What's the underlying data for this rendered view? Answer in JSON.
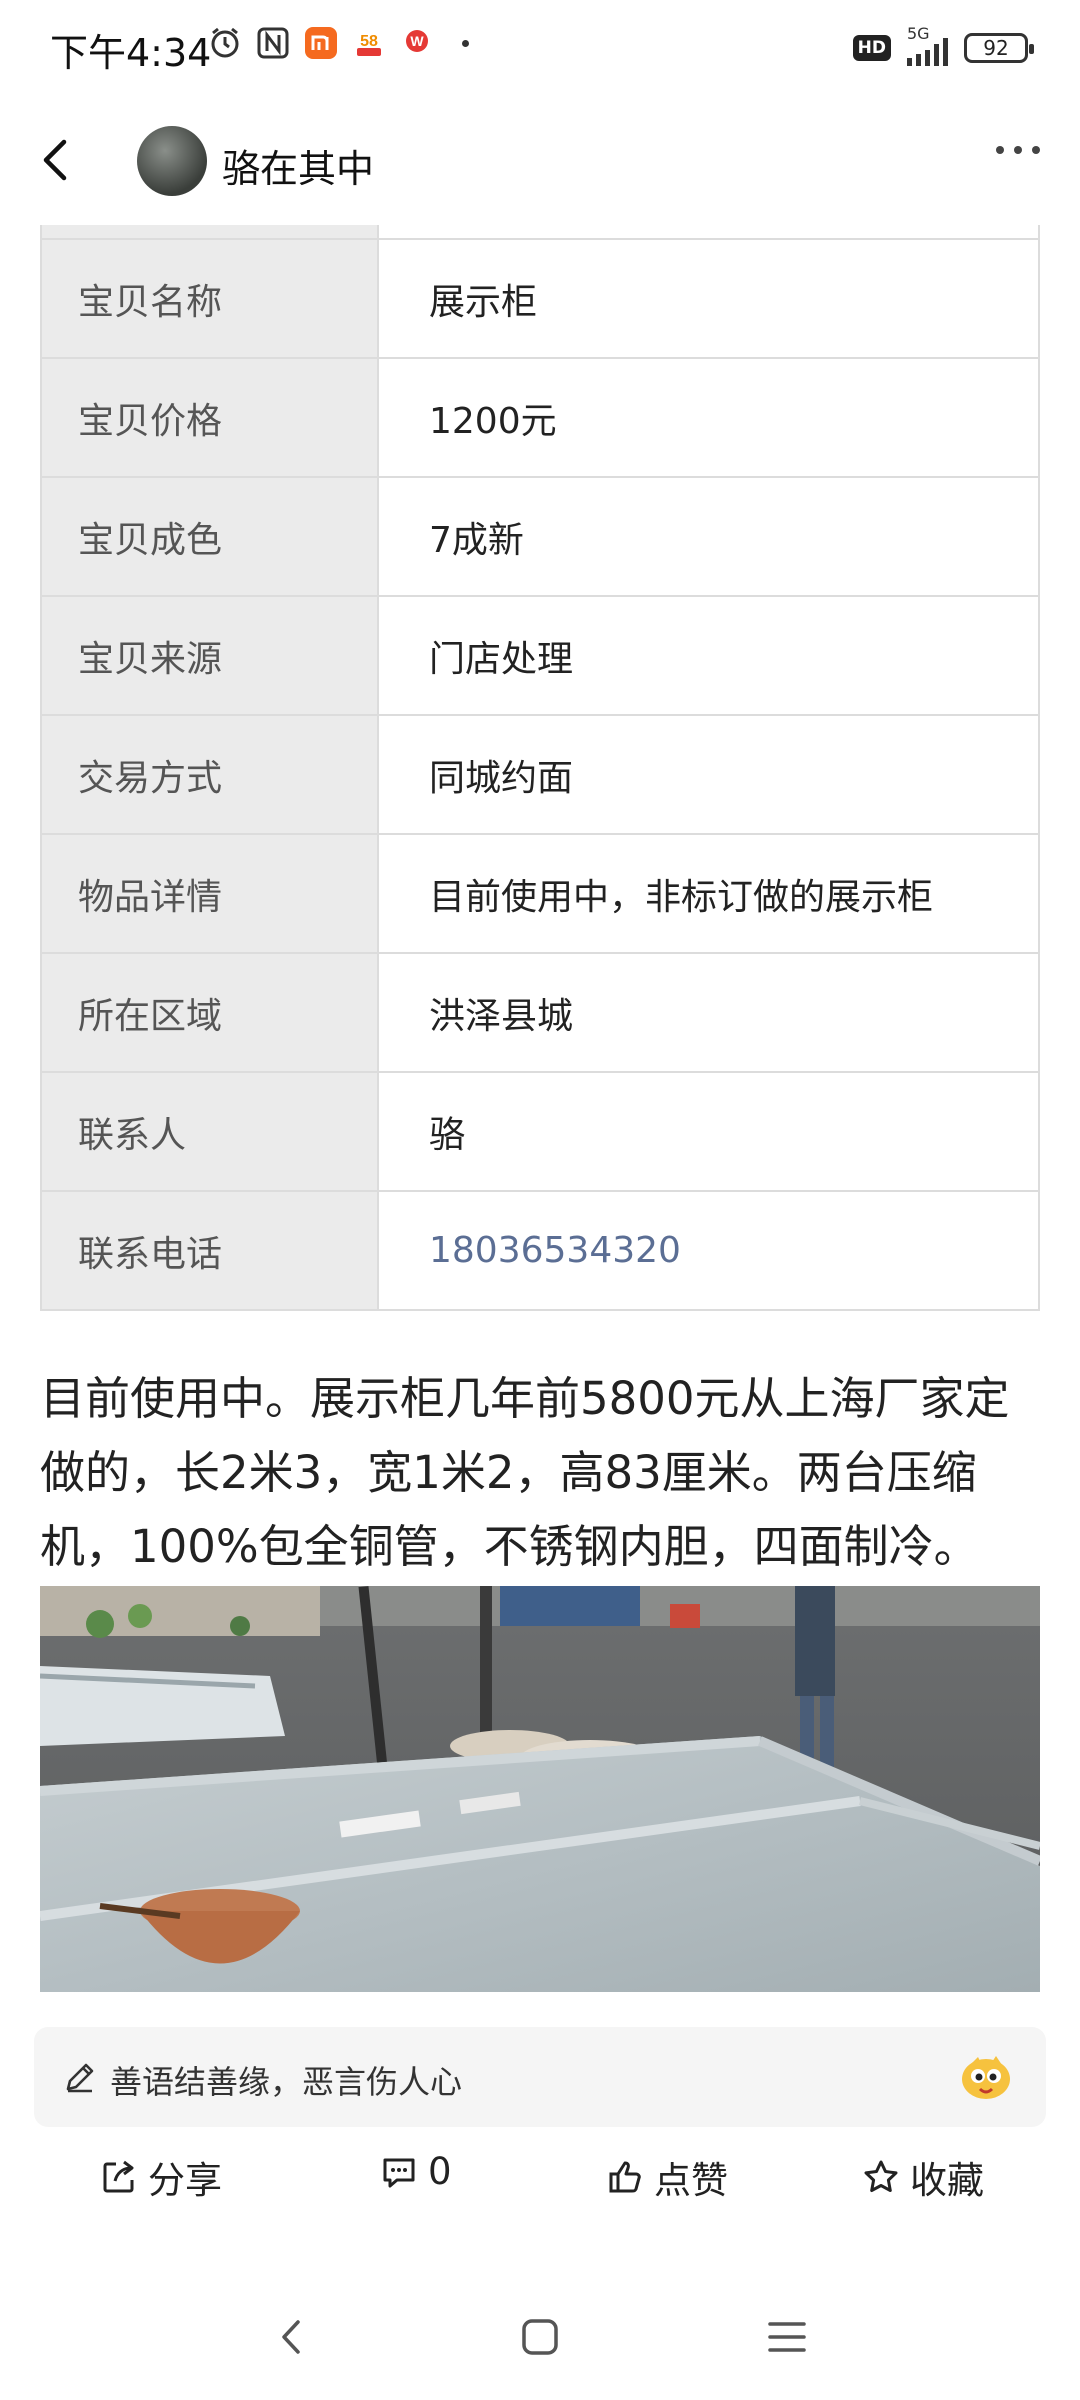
{
  "status_bar": {
    "time": "下午4:34",
    "icon_58": "58",
    "network": "5G",
    "hd": "HD",
    "battery": "92"
  },
  "header": {
    "title": "骆在其中"
  },
  "info_table": [
    {
      "label": "宝贝名称",
      "value": "展示柜"
    },
    {
      "label": "宝贝价格",
      "value": "1200元"
    },
    {
      "label": "宝贝成色",
      "value": "7成新"
    },
    {
      "label": "宝贝来源",
      "value": "门店处理"
    },
    {
      "label": "交易方式",
      "value": "同城约面"
    },
    {
      "label": "物品详情",
      "value": "目前使用中，非标订做的展示柜"
    },
    {
      "label": "所在区域",
      "value": "洪泽县城"
    },
    {
      "label": "联系人",
      "value": "骆"
    },
    {
      "label": "联系电话",
      "value": "18036534320"
    }
  ],
  "article": {
    "text": "目前使用中。展示柜几年前5800元从上海厂家定做的，长2米3，宽1米2，高83厘米。两台压缩机，100%包全铜管，不锈钢内胆，四面制冷。"
  },
  "comment_bar": {
    "placeholder": "善语结善缘，恶言伤人心"
  },
  "actions": {
    "share": "分享",
    "comment_count": "0",
    "like": "点赞",
    "favorite": "收藏"
  }
}
